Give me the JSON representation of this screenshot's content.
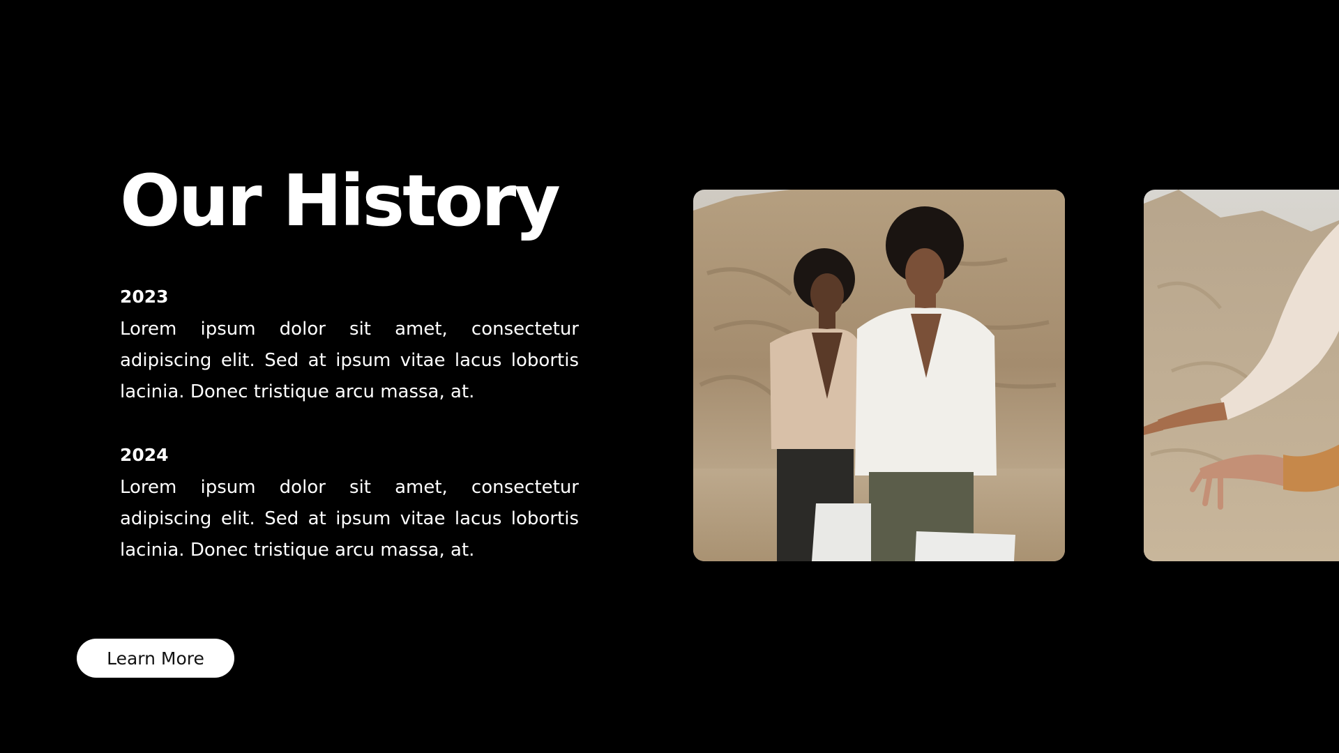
{
  "page": {
    "title": "Our History",
    "background": "#000000",
    "text_color": "#ffffff"
  },
  "history": [
    {
      "year": "2023",
      "text": "Lorem ipsum dolor sit amet, consectetur adipiscing elit. Sed at ipsum vitae lacus lobortis lacinia. Donec tristique arcu massa, at."
    },
    {
      "year": "2024",
      "text": "Lorem ipsum dolor sit amet, consectetur adipiscing elit. Sed at ipsum vitae lacus lobortis lacinia. Donec tristique arcu massa, at."
    }
  ],
  "cta": {
    "label": "Learn More",
    "background": "#ffffff",
    "text_color": "#111111"
  },
  "gallery": {
    "images": [
      {
        "icon": "photo-two-models-desert"
      },
      {
        "icon": "photo-hands-reaching-desert"
      }
    ]
  }
}
